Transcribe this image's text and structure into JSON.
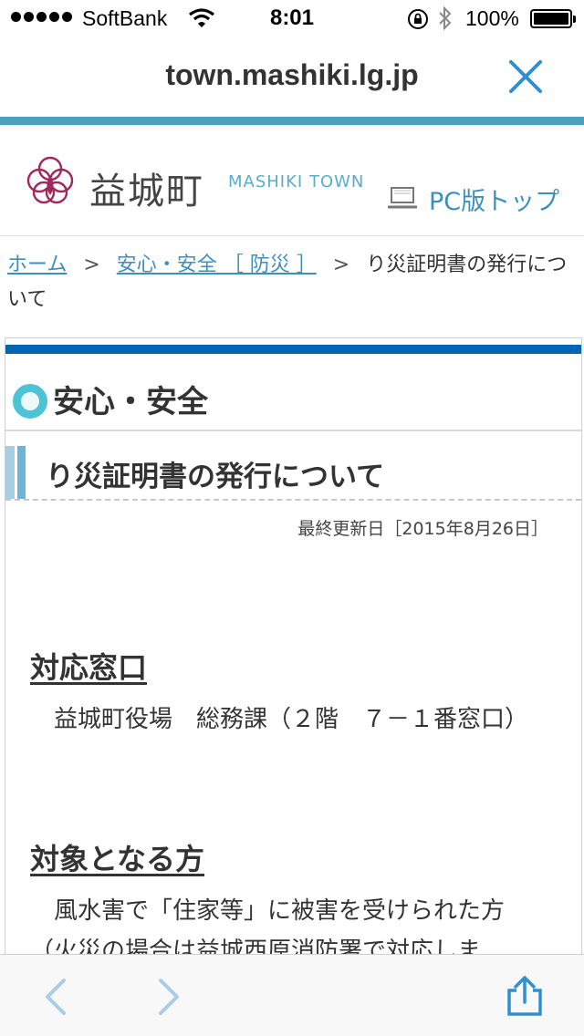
{
  "status_bar": {
    "carrier": "SoftBank",
    "time": "8:01",
    "battery": "100%"
  },
  "browser": {
    "domain": "town.mashiki.lg.jp"
  },
  "site": {
    "name": "益城町",
    "name_en": "MASHIKI TOWN",
    "pc_link": "PC版トップ"
  },
  "breadcrumb": {
    "home": "ホーム",
    "separator": ">",
    "category": "安心・安全 ［ 防災 ］",
    "current": "り災証明書の発行について"
  },
  "content": {
    "section_title": "安心・安全",
    "page_title": "り災証明書の発行について",
    "updated": "最終更新日［2015年8月26日］",
    "sections": [
      {
        "heading": "対応窓口",
        "body": "益城町役場　総務課（２階　７－１番窓口）"
      },
      {
        "heading": "対象となる方",
        "body": "風水害で「住家等」に被害を受けられた方（火災の場合は益城西原消防署で対応しま"
      }
    ]
  },
  "colors": {
    "accent_teal": "#4a9fbd",
    "link_blue": "#3d8fbd",
    "header_blue": "#0066b3",
    "logo_magenta": "#a0285a"
  },
  "icons": {
    "close": "close-icon",
    "pc": "laptop-icon",
    "back": "chevron-left-icon",
    "forward": "chevron-right-icon",
    "share": "share-icon"
  }
}
